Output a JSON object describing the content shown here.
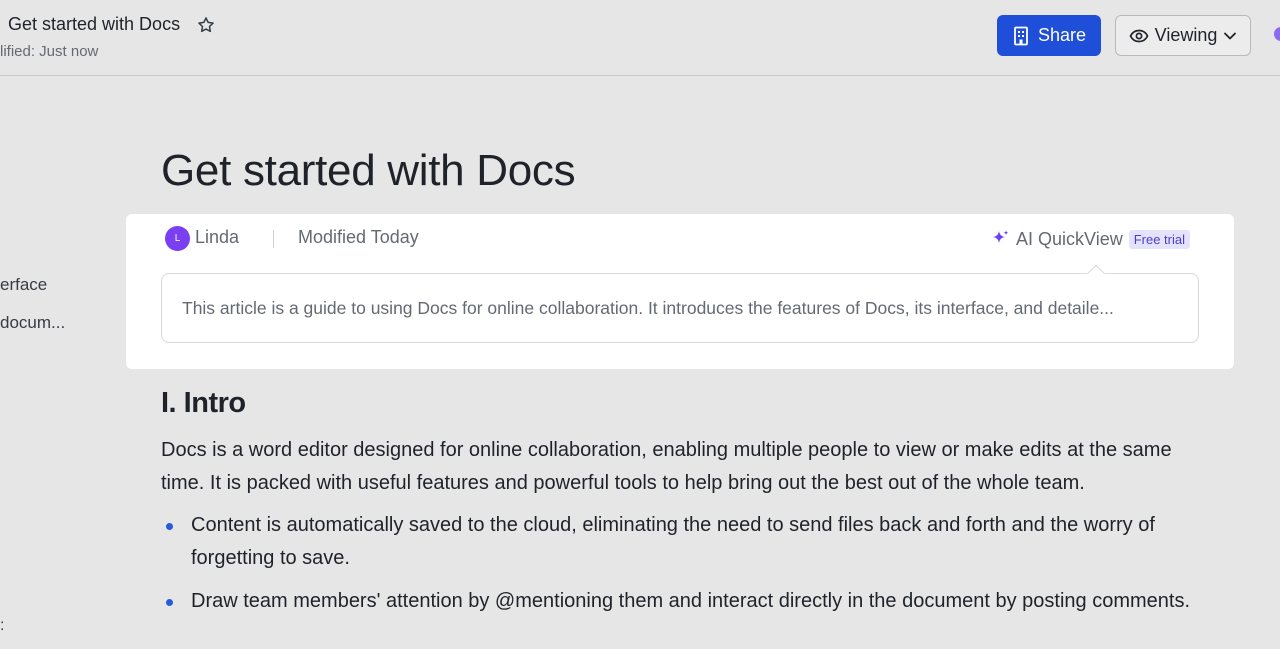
{
  "header": {
    "doc_title": "Get started with Docs",
    "last_modified": "lified: Just now",
    "share_label": "Share",
    "viewing_label": "Viewing"
  },
  "outline": {
    "items": [
      "erface",
      "docum..."
    ],
    "stray_char": ":"
  },
  "document": {
    "title": "Get started with Docs",
    "author": "Linda",
    "author_initial": "L",
    "modified": "Modified Today",
    "ai_quickview_label": "AI QuickView",
    "free_trial_badge": "Free trial",
    "summary": "This article is a guide to using Docs for online collaboration. It introduces the features of Docs, its interface, and detaile...",
    "section_heading": "I. Intro",
    "intro_paragraph": "Docs is a word editor designed for online collaboration, enabling multiple people to view or make edits at the same time. It is packed with useful features and powerful tools to help bring out the best out of the whole team.",
    "bullets": [
      "Content is automatically saved to the cloud, eliminating the need to send files back and forth and the worry of forgetting to save.",
      "Draw team members' attention by @mentioning them and interact directly in the document by posting comments."
    ]
  },
  "colors": {
    "share_button": "#1f4fd9",
    "avatar": "#7b3ff2",
    "bullet": "#245bdb",
    "badge_bg": "#e4e3fb",
    "badge_text": "#4b3fd1"
  },
  "icons": {
    "star": "star-icon",
    "share": "building-icon",
    "viewing": "eye-icon",
    "chevron": "chevron-down-icon",
    "ai": "sparkle-icon"
  }
}
